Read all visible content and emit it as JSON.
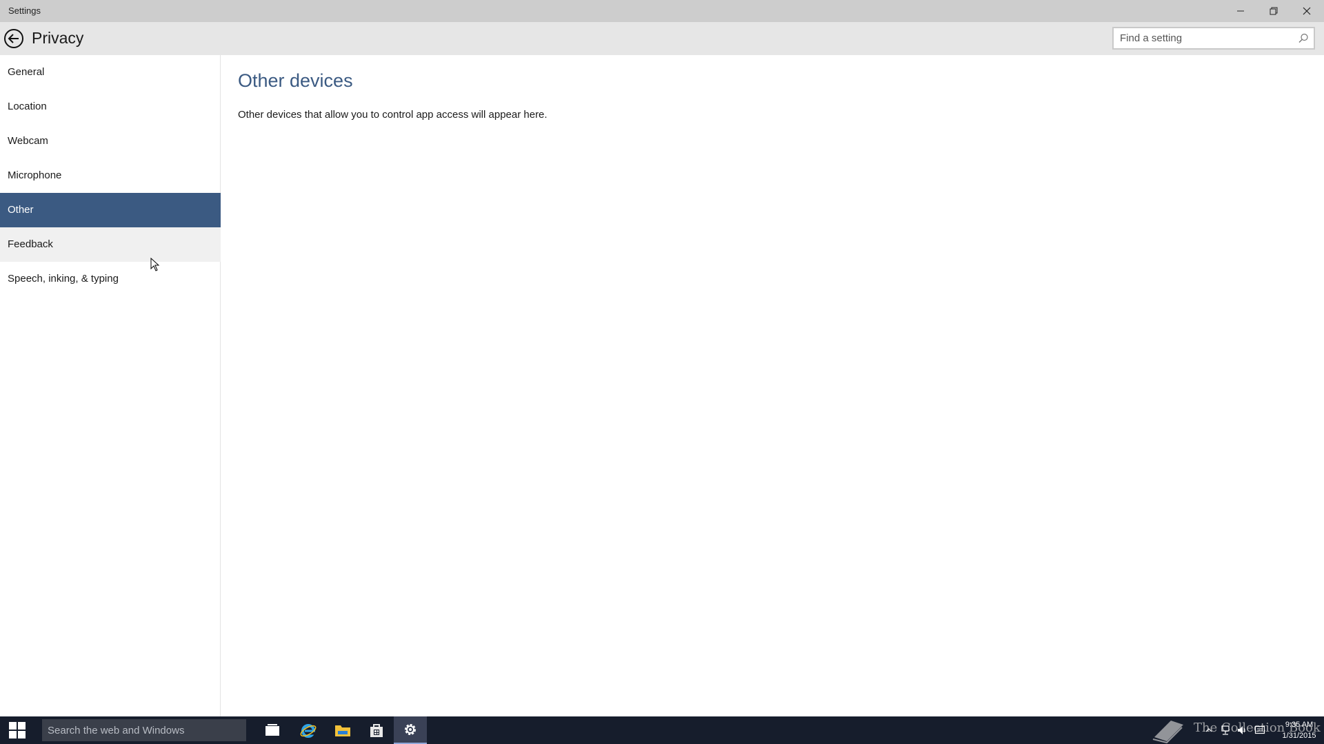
{
  "window": {
    "title": "Settings"
  },
  "header": {
    "page_title": "Privacy",
    "search_placeholder": "Find a setting"
  },
  "sidebar": {
    "selected": "Other",
    "items": [
      {
        "label": "General"
      },
      {
        "label": "Location"
      },
      {
        "label": "Webcam"
      },
      {
        "label": "Microphone"
      },
      {
        "label": "Other"
      },
      {
        "label": "Feedback"
      },
      {
        "label": "Speech, inking, & typing"
      }
    ]
  },
  "main": {
    "title": "Other devices",
    "description": "Other devices that allow you to control app access will appear here."
  },
  "taskbar": {
    "search_placeholder": "Search the web and Windows",
    "watermark": "The Collection Book",
    "clock_time": "9:35 AM",
    "clock_date": "1/31/2015",
    "icons": [
      "task-view-icon",
      "internet-explorer-icon",
      "file-explorer-icon",
      "store-icon",
      "settings-icon"
    ]
  },
  "colors": {
    "accent": "#3b5a82",
    "titlebar": "#cdcdcd",
    "header": "#e6e6e6",
    "taskbar": "#161d2c"
  }
}
